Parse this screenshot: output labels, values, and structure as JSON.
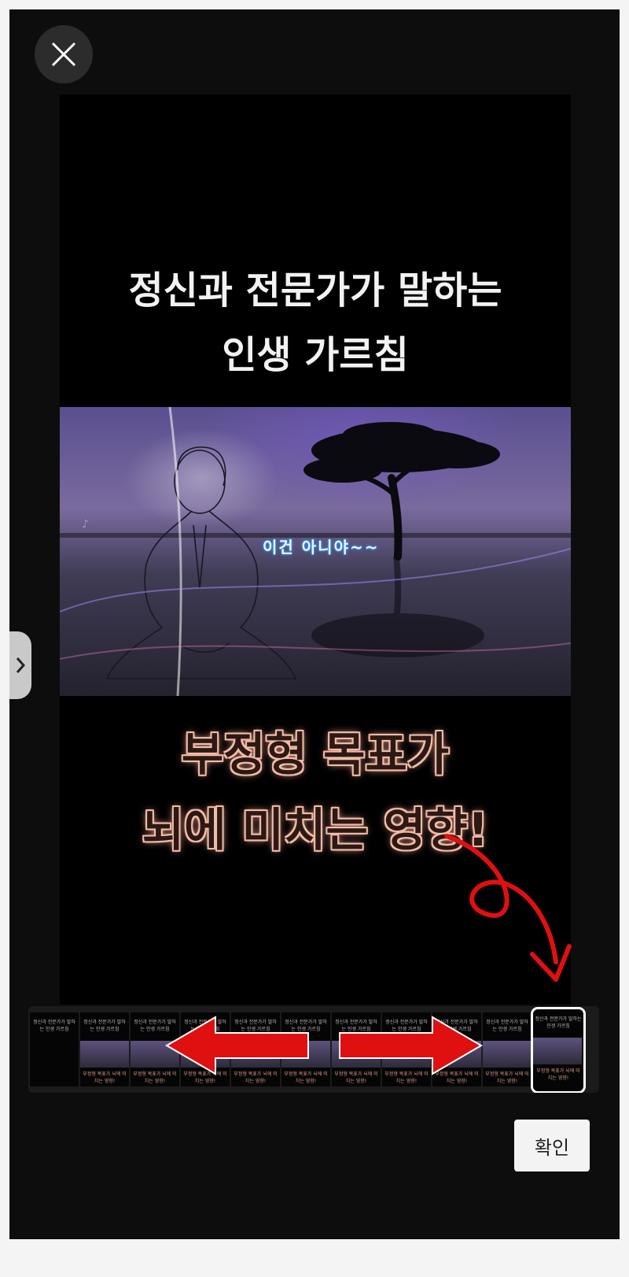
{
  "dialog": {
    "close_icon": "close-icon",
    "side_tab_icon": "chevron-right-icon"
  },
  "preview": {
    "headline_line1": "정신과 전문가가 말하는",
    "headline_line2": "인생 가르침",
    "overlay_caption": "이건 아니야~~",
    "subheadline_line1": "부정형 목표가",
    "subheadline_line2": "뇌에 미치는 영향!",
    "colors": {
      "headline": "#f2f2f2",
      "subheadline_glow": "#f5b7a3",
      "caption_glow": "#2aa0ff"
    }
  },
  "filmstrip": {
    "thumb_count": 11,
    "selected_index": 10,
    "thumb_text_line1": "정신과 전문가가 말하는",
    "thumb_text_line2": "인생 가르침",
    "thumb_text_line3": "부정형 목표가",
    "thumb_text_line4": "뇌에 미치는 영향!"
  },
  "footer": {
    "confirm_label": "확인"
  },
  "annotations": {
    "arrow_color": "#e01010"
  }
}
